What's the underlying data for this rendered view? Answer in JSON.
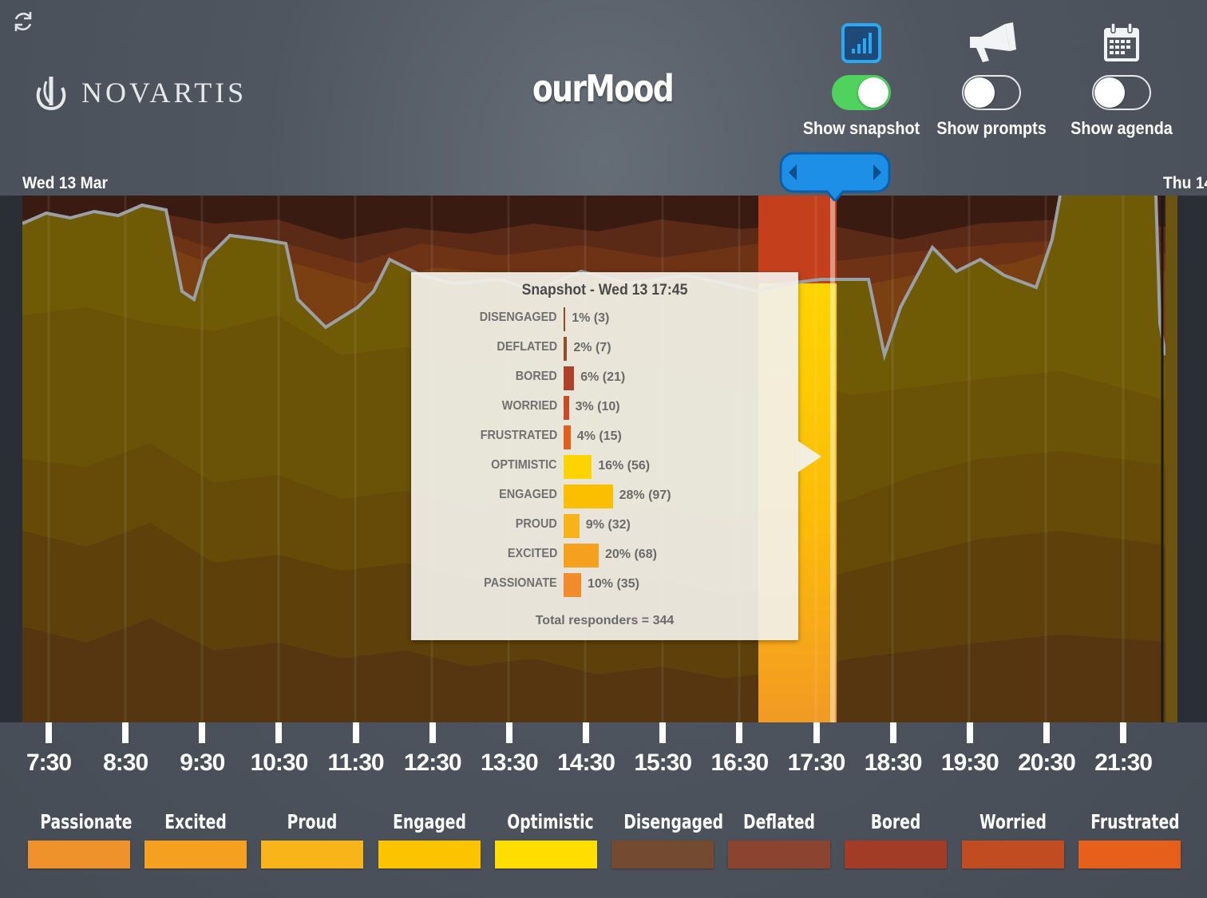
{
  "header": {
    "app_title": "ourMood",
    "brand": "NOVARTIS",
    "refresh_icon": "refresh-icon"
  },
  "controls": [
    {
      "label": "Show snapshot",
      "icon": "bar-chart-icon",
      "on": true
    },
    {
      "label": "Show prompts",
      "icon": "megaphone-icon",
      "on": false
    },
    {
      "label": "Show agenda",
      "icon": "calendar-icon",
      "on": false
    }
  ],
  "dates": {
    "start": "Wed 13 Mar",
    "end": "Thu 14"
  },
  "snapshot": {
    "title": "Snapshot - Wed 13 17:45",
    "rows": [
      {
        "label": "DISENGAGED",
        "value": "1% (3)",
        "pct": 1,
        "color": "#8a4a28"
      },
      {
        "label": "DEFLATED",
        "value": "2% (7)",
        "pct": 2,
        "color": "#9a4a2a"
      },
      {
        "label": "BORED",
        "value": "6% (21)",
        "pct": 6,
        "color": "#b0402a"
      },
      {
        "label": "WORRIED",
        "value": "3% (10)",
        "pct": 3,
        "color": "#cc4a22"
      },
      {
        "label": "FRUSTRATED",
        "value": "4% (15)",
        "pct": 4,
        "color": "#e35d1c"
      },
      {
        "label": "OPTIMISTIC",
        "value": "16% (56)",
        "pct": 16,
        "color": "#fdd400"
      },
      {
        "label": "ENGAGED",
        "value": "28% (97)",
        "pct": 28,
        "color": "#fcbf00"
      },
      {
        "label": "PROUD",
        "value": "9% (32)",
        "pct": 9,
        "color": "#f9b31a"
      },
      {
        "label": "EXCITED",
        "value": "20% (68)",
        "pct": 20,
        "color": "#f6a020"
      },
      {
        "label": "PASSIONATE",
        "value": "10% (35)",
        "pct": 10,
        "color": "#f08c2c"
      }
    ],
    "total": "Total responders = 344"
  },
  "time_axis": [
    "7:30",
    "8:30",
    "9:30",
    "10:30",
    "11:30",
    "12:30",
    "13:30",
    "14:30",
    "15:30",
    "16:30",
    "17:30",
    "18:30",
    "19:30",
    "20:30",
    "21:30"
  ],
  "legend": [
    {
      "label": "Passionate",
      "color": "#f0922c"
    },
    {
      "label": "Excited",
      "color": "#f6a01f"
    },
    {
      "label": "Proud",
      "color": "#f9b41a"
    },
    {
      "label": "Engaged",
      "color": "#fcc400"
    },
    {
      "label": "Optimistic",
      "color": "#fedd00"
    },
    {
      "label": "Disengaged",
      "color": "#744a30"
    },
    {
      "label": "Deflated",
      "color": "#8b4430"
    },
    {
      "label": "Bored",
      "color": "#a23c26"
    },
    {
      "label": "Worried",
      "color": "#c24c22"
    },
    {
      "label": "Frustrated",
      "color": "#e6601c"
    }
  ]
}
